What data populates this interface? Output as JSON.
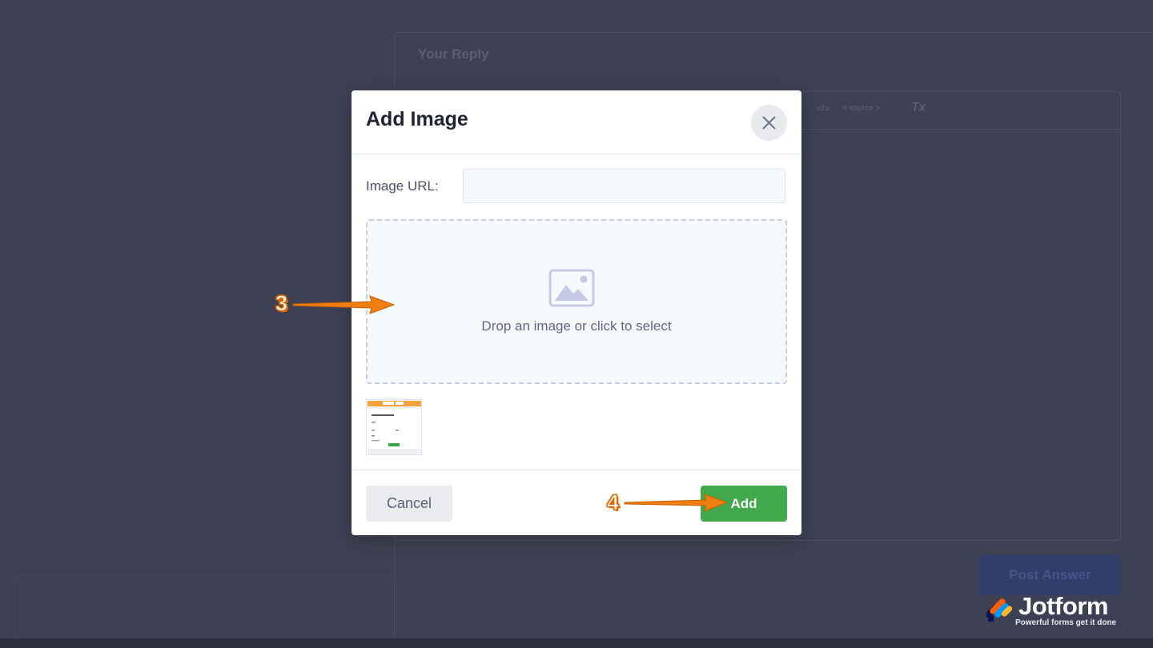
{
  "background": {
    "reply_title": "Your Reply",
    "toolbar": {
      "code_label": "</>",
      "source_label": "< source >",
      "clear_format_label": "Tx"
    },
    "post_button_label": "Post Answer"
  },
  "modal": {
    "title": "Add Image",
    "url_label": "Image URL:",
    "url_value": "",
    "dropzone_text": "Drop an image or click to select",
    "cancel_label": "Cancel",
    "add_label": "Add"
  },
  "annotations": {
    "step3": "3",
    "step4": "4"
  },
  "watermark": {
    "brand": "Jotform",
    "tagline": "Powerful forms get it done"
  },
  "colors": {
    "overlay": "#3d4153",
    "add_button": "#42a84c",
    "cancel_button": "#e9ebef",
    "annotation": "#f07f11"
  },
  "icons": [
    "close-icon",
    "image-placeholder-icon",
    "jotform-logo-icon"
  ]
}
